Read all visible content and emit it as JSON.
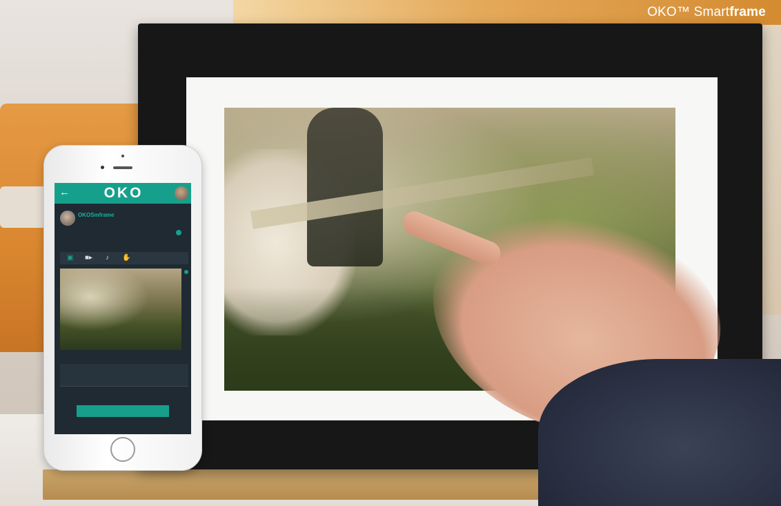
{
  "banner": {
    "brand_prefix": "OKO™ Smart",
    "brand_suffix": "frame"
  },
  "app": {
    "logo": "OKO",
    "back_icon": "arrow-left-icon",
    "contact": {
      "name": "OKOSmframe",
      "sub": "",
      "meta": ""
    },
    "toolbar_icons": [
      "image-icon",
      "video-icon",
      "microphone-icon",
      "hand-icon"
    ],
    "message": {
      "label": "",
      "text": "",
      "send_label": ""
    }
  },
  "colors": {
    "accent": "#16a08c",
    "app_background": "#1f2a33",
    "frame": "#171717",
    "banner": "#e4a95a"
  }
}
